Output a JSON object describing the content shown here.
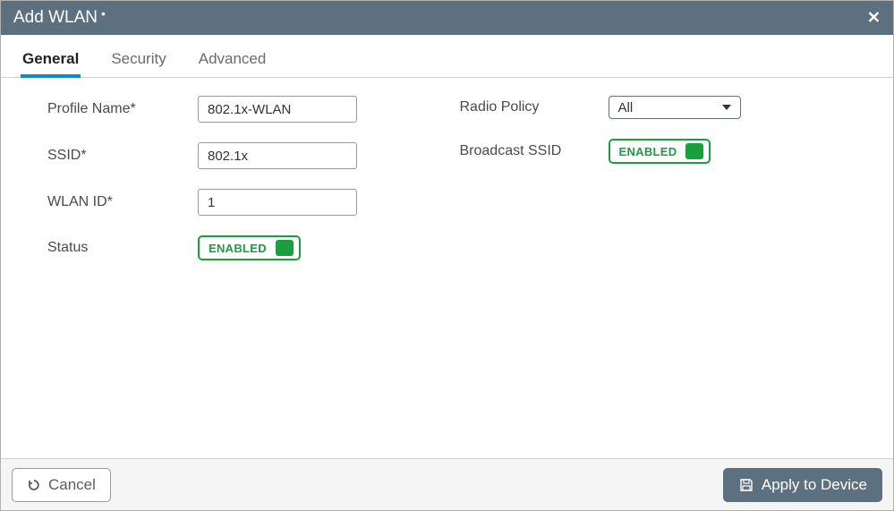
{
  "modal": {
    "title": "Add WLAN"
  },
  "tabs": [
    {
      "label": "General",
      "active": true
    },
    {
      "label": "Security",
      "active": false
    },
    {
      "label": "Advanced",
      "active": false
    }
  ],
  "form": {
    "profile_name": {
      "label": "Profile Name*",
      "value": "802.1x-WLAN"
    },
    "ssid": {
      "label": "SSID*",
      "value": "802.1x"
    },
    "wlan_id": {
      "label": "WLAN ID*",
      "value": "1"
    },
    "status": {
      "label": "Status",
      "state": "ENABLED"
    },
    "radio_policy": {
      "label": "Radio Policy",
      "selected": "All"
    },
    "broadcast_ssid": {
      "label": "Broadcast SSID",
      "state": "ENABLED"
    }
  },
  "footer": {
    "cancel": "Cancel",
    "apply": "Apply to Device"
  }
}
